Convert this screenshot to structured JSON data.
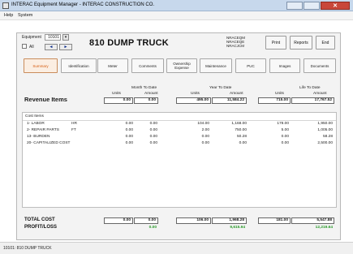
{
  "window": {
    "title": "INTERAC Equipment Manager - INTERAC CONSTRUCTION CO.",
    "close_glyph": "✕"
  },
  "menu": {
    "items": [
      "Help",
      "System"
    ]
  },
  "equipment": {
    "label": "Equipment",
    "number": "10101",
    "all_label": "All",
    "prev_glyph": "◄",
    "next_glyph": "►",
    "dropdown_glyph": "▾",
    "title": "810 DUMP TRUCK",
    "codes": [
      "NRACEQM",
      "NRACEQE",
      "NRACJCM"
    ]
  },
  "toolbar": {
    "print": "Print",
    "reports": "Reports",
    "end": "End"
  },
  "tabs": [
    {
      "label": "Summary",
      "active": true
    },
    {
      "label": "Identification",
      "active": false
    },
    {
      "label": "Meter",
      "active": false
    },
    {
      "label": "Comments",
      "active": false
    },
    {
      "label": "Ownership Expense",
      "active": false
    },
    {
      "label": "Maintenance",
      "active": false
    },
    {
      "label": "PUC",
      "active": false
    },
    {
      "label": "Images",
      "active": false
    },
    {
      "label": "Documents",
      "active": false
    }
  ],
  "columns": {
    "mtd": "Month To Date",
    "ytd": "Year To Date",
    "ltd": "Life To Date",
    "units": "Units",
    "amount": "Amount"
  },
  "revenue": {
    "title": "Revenue Items",
    "mtd_units": "0.00",
    "mtd_amount": "0.00",
    "ytd_units": "495.00",
    "ytd_amount": "11,584.22",
    "ltd_units": "715.00",
    "ltd_amount": "17,767.52"
  },
  "cost_items": {
    "header": "Cost Items",
    "rows": [
      {
        "name": "1- LABOR",
        "unit": "HR",
        "mtd_u": "0.00",
        "mtd_a": "0.00",
        "ytd_u": "104.00",
        "ytd_a": "1,168.00",
        "ltd_u": "178.00",
        "ltd_a": "1,950.00"
      },
      {
        "name": "2- REPAIR PARTS",
        "unit": "FT",
        "mtd_u": "0.00",
        "mtd_a": "0.00",
        "ytd_u": "2.00",
        "ytd_a": "750.00",
        "ltd_u": "5.00",
        "ltd_a": "1,005.00"
      },
      {
        "name": "13- BURDEN",
        "unit": "",
        "mtd_u": "0.00",
        "mtd_a": "0.00",
        "ytd_u": "0.00",
        "ytd_a": "50.28",
        "ltd_u": "0.00",
        "ltd_a": "58.28"
      },
      {
        "name": "20- CAPITALIZED COST",
        "unit": "",
        "mtd_u": "0.00",
        "mtd_a": "0.00",
        "ytd_u": "0.00",
        "ytd_a": "0.00",
        "ltd_u": "0.00",
        "ltd_a": "2,500.00"
      }
    ]
  },
  "totals": {
    "total_label": "TOTAL COST",
    "profit_label": "PROFIT/LOSS",
    "mtd_units": "0.00",
    "mtd_amount": "0.00",
    "ytd_units": "106.00",
    "ytd_amount": "1,968.28",
    "ltd_units": "181.00",
    "ltd_amount": "5,547.88",
    "mtd_profit": "0.00",
    "ytd_profit": "9,615.94",
    "ltd_profit": "12,219.64"
  },
  "status": {
    "text": "10101: 810 DUMP TRUCK"
  },
  "colors": {
    "active_tab": "#d65c10",
    "profit": "#2b9a2b",
    "titlebar": "#c7d8ec"
  }
}
